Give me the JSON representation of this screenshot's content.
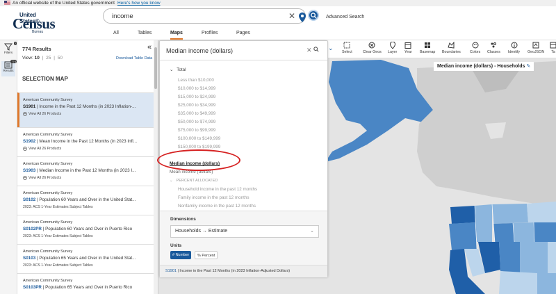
{
  "gov_banner": {
    "text": "An official website of the United States government",
    "link": "Here's how you know"
  },
  "logo": {
    "line1": "United States®",
    "line2": "Census",
    "line3": "Bureau"
  },
  "search": {
    "value": "income",
    "advanced": "Advanced Search"
  },
  "tabs": [
    {
      "label": "All",
      "active": false
    },
    {
      "label": "Tables",
      "active": false
    },
    {
      "label": "Maps",
      "active": true
    },
    {
      "label": "Profiles",
      "active": false
    },
    {
      "label": "Pages",
      "active": false
    }
  ],
  "rail": {
    "filters": "Filters",
    "filters_badge": "2",
    "results": "Results",
    "results_badge": "774"
  },
  "results": {
    "count": "774 Results",
    "view_label": "View:",
    "view_options": [
      "10",
      "25",
      "50"
    ],
    "download": "Download Table Data",
    "section": "SELECTION MAP",
    "items": [
      {
        "source": "American Community Survey",
        "code": "S1901",
        "title": "Income in the Past 12 Months (in 2023 Inflation-...",
        "sub": "View All 26 Products",
        "active": true
      },
      {
        "source": "American Community Survey",
        "code": "S1902",
        "title": "Mean Income in the Past 12 Months (in 2023 Infl...",
        "sub": "View All 26 Products",
        "active": false
      },
      {
        "source": "American Community Survey",
        "code": "S1903",
        "title": "Median Income in the Past 12 Months (in 2023 I...",
        "sub": "View All 26 Products",
        "active": false
      },
      {
        "source": "American Community Survey",
        "code": "S0102",
        "title": "Population 60 Years and Over in the United Stat...",
        "sub": "2023: ACS 1-Year Estimates Subject Tables",
        "active": false
      },
      {
        "source": "American Community Survey",
        "code": "S0102PR",
        "title": "Population 60 Years and Over in Puerto Rico",
        "sub": "2023: ACS 1-Year Estimates Subject Tables",
        "active": false
      },
      {
        "source": "American Community Survey",
        "code": "S0103",
        "title": "Population 65 Years and Over in the United Stat...",
        "sub": "2023: ACS 1-Year Estimates Subject Tables",
        "active": false
      },
      {
        "source": "American Community Survey",
        "code": "S0103PR",
        "title": "Population 65 Years and Over in Puerto Rico",
        "sub": "",
        "active": false
      }
    ]
  },
  "toolbar": [
    {
      "label": "Select",
      "icon": "select-icon"
    },
    {
      "label": "Clear Geos",
      "icon": "clear-geos-icon"
    },
    {
      "label": "Layer",
      "icon": "layer-icon"
    },
    {
      "label": "Year",
      "icon": "calendar-icon"
    },
    {
      "label": "Basemap",
      "icon": "basemap-icon"
    },
    {
      "label": "Boundaries",
      "icon": "boundaries-icon"
    },
    {
      "label": "Colors",
      "icon": "colors-icon"
    },
    {
      "label": "Classes",
      "icon": "classes-icon"
    },
    {
      "label": "Identify",
      "icon": "info-icon"
    },
    {
      "label": "GeoJSON",
      "icon": "geojson-icon"
    },
    {
      "label": "Ta",
      "icon": "table-icon"
    }
  ],
  "map_label": "Median income (dollars) - Households",
  "panel": {
    "title": "Median income (dollars)",
    "group_total": "Total",
    "total_items": [
      "Less than $10,000",
      "$10,000 to $14,999",
      "$15,000 to $24,999",
      "$25,000 to $34,999",
      "$35,000 to $49,999",
      "$50,000 to $74,999",
      "$75,000 to $99,999",
      "$100,000 to $149,999",
      "$150,000 to $199,999"
    ],
    "selected_item": "Median income (dollars)",
    "mean_item": "Mean income (dollars)",
    "group_percent": "PERCENT ALLOCATED",
    "percent_items": [
      "Household income in the past 12 months",
      "Family income in the past 12 months",
      "Nonfamily income in the past 12 months"
    ],
    "dimensions_label": "Dimensions",
    "dimension_value": "Households → Estimate",
    "units_label": "Units",
    "unit_number": "# Number",
    "unit_percent": "% Percent",
    "footer_code": "S1901",
    "footer_text": "| Income in the Past 12 Months (in 2023 Inflation-Adjusted Dollars)"
  },
  "colors": {
    "accent": "#e0782a",
    "primary": "#1a5a9c",
    "highlight_ring": "#d62222"
  }
}
